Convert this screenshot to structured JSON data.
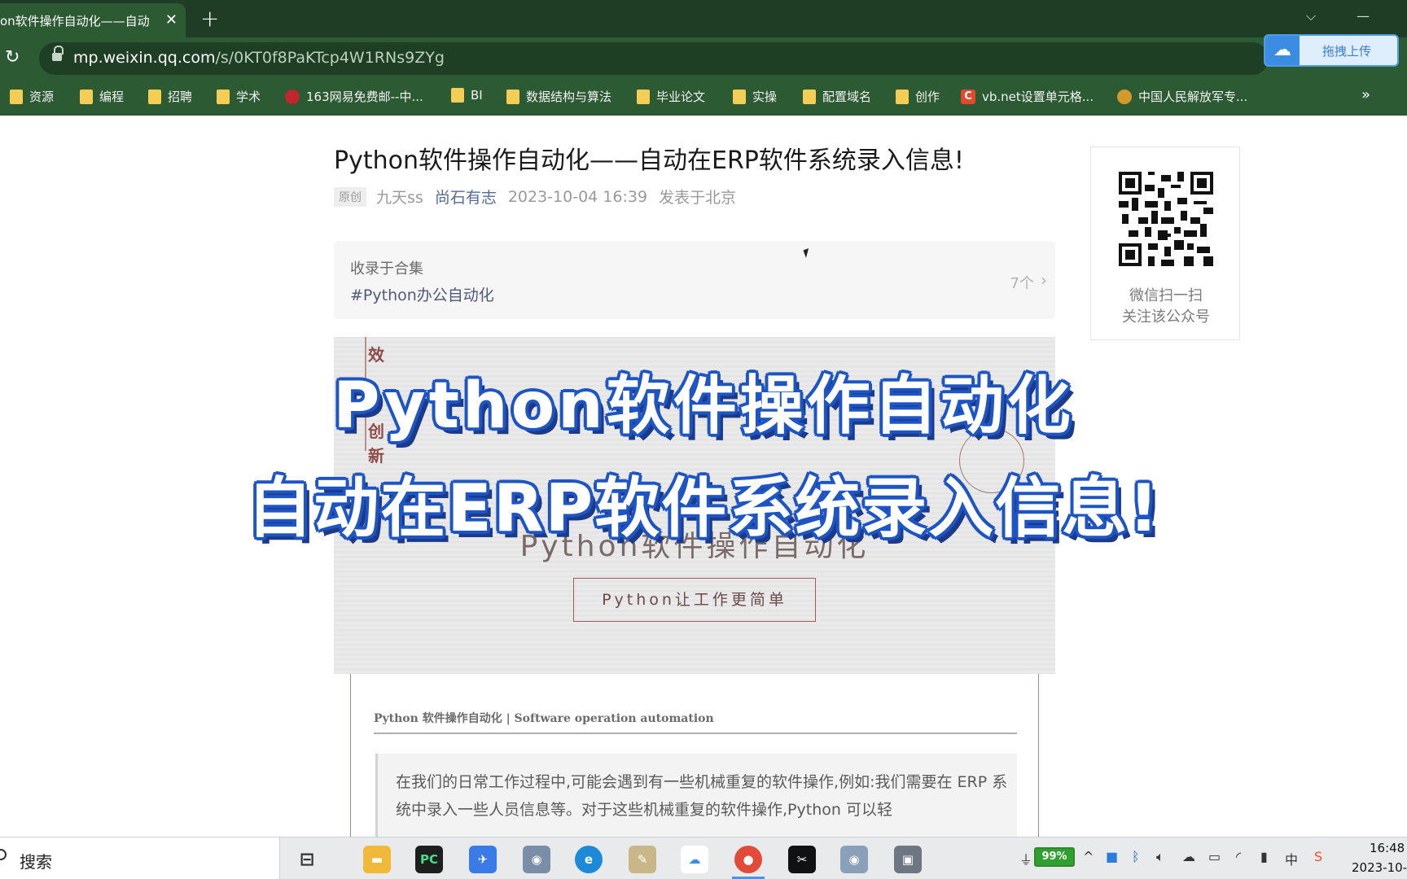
{
  "browser": {
    "tab_title": "on软件操作自动化——自动",
    "tab_close": "✕",
    "new_tab": "+",
    "url_host": "mp.weixin.qq.com",
    "url_path": "/s/0KT0f8PaKTcp4W1RNs9ZYg",
    "upload_button": "拖拽上传",
    "bookmarks_more": "»",
    "bookmarks": [
      {
        "label": "资源",
        "icon": "folder"
      },
      {
        "label": "编程",
        "icon": "folder"
      },
      {
        "label": "招聘",
        "icon": "folder"
      },
      {
        "label": "学术",
        "icon": "folder"
      },
      {
        "label": "163网易免费邮--中...",
        "icon": "netease-icon"
      },
      {
        "label": "BI",
        "icon": "folder"
      },
      {
        "label": "数据结构与算法",
        "icon": "folder"
      },
      {
        "label": "毕业论文",
        "icon": "folder"
      },
      {
        "label": "实操",
        "icon": "folder"
      },
      {
        "label": "配置域名",
        "icon": "folder"
      },
      {
        "label": "创作",
        "icon": "folder"
      },
      {
        "label": "vb.net设置单元格...",
        "icon": "csdn-icon"
      },
      {
        "label": "中国人民解放军专...",
        "icon": "emblem-icon"
      }
    ]
  },
  "article": {
    "title": "Python软件操作自动化——自动在ERP软件系统录入信息!",
    "badge": "原创",
    "author": "九天ss",
    "account": "尚石有志",
    "date": "2023-10-04 16:39",
    "location": "发表于北京",
    "collection_label": "收录于合集",
    "collection_tag": "#Python办公自动化",
    "collection_count": "7个",
    "qr_line1": "微信扫一扫",
    "qr_line2": "关注该公众号",
    "cover": {
      "vtext": [
        "效",
        "创",
        "新"
      ],
      "subtitle": "Python软件操作自动化",
      "button": "Python让工作更简单"
    },
    "section_heading": "Python 软件操作自动化 | Software operation automation",
    "intro": "在我们的日常工作过程中,可能会遇到有一些机械重复的软件操作,例如:我们需要在 ERP 系统中录入一些人员信息等。对于这些机械重复的软件操作,Python 可以轻"
  },
  "overlay_caption": {
    "line1": "Python软件操作自动化",
    "line2": "自动在ERP软件系统录入信息!"
  },
  "taskbar": {
    "search_label": "搜索",
    "battery": "99%",
    "time": "16:48",
    "date": "2023-10-"
  }
}
